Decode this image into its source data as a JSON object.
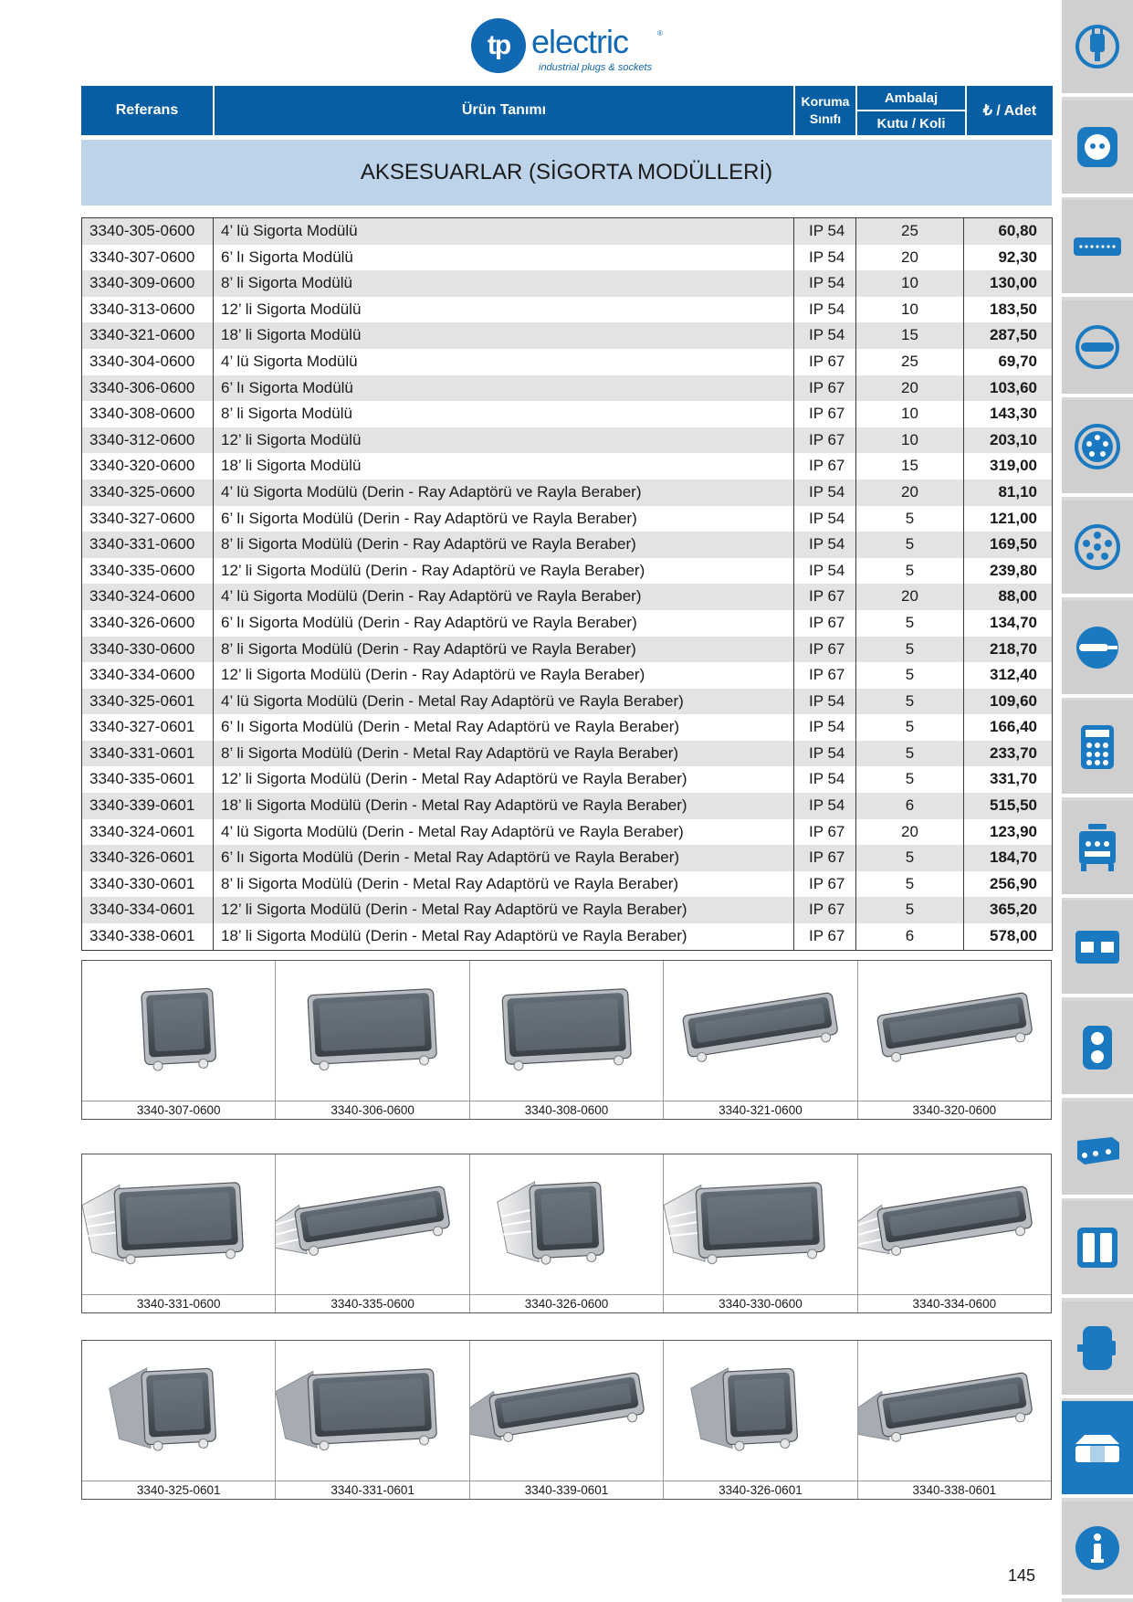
{
  "brand": {
    "logo_mark": "tp",
    "logo_word": "electric",
    "reg": "®",
    "tagline": "industrial plugs & sockets"
  },
  "header": {
    "referans": "Referans",
    "urun_tanimi": "Ürün Tanımı",
    "koruma_sinifi": "Koruma Sınıfı",
    "ambalaj": "Ambalaj",
    "kutu_koli": "Kutu / Koli",
    "fiyat": "₺ / Adet"
  },
  "section_title": "AKSESUARLAR (SİGORTA MODÜLLERİ)",
  "rows": [
    {
      "ref": "3340-305-0600",
      "desc": "4’ lü Sigorta Modülü",
      "ip": "IP 54",
      "pack": "25",
      "price": "60,80"
    },
    {
      "ref": "3340-307-0600",
      "desc": "6’ lı Sigorta Modülü",
      "ip": "IP 54",
      "pack": "20",
      "price": "92,30"
    },
    {
      "ref": "3340-309-0600",
      "desc": "8’ li Sigorta Modülü",
      "ip": "IP 54",
      "pack": "10",
      "price": "130,00"
    },
    {
      "ref": "3340-313-0600",
      "desc": "12’ li Sigorta Modülü",
      "ip": "IP 54",
      "pack": "10",
      "price": "183,50"
    },
    {
      "ref": "3340-321-0600",
      "desc": "18’ li Sigorta Modülü",
      "ip": "IP 54",
      "pack": "15",
      "price": "287,50"
    },
    {
      "ref": "3340-304-0600",
      "desc": "4’ lü Sigorta Modülü",
      "ip": "IP 67",
      "pack": "25",
      "price": "69,70"
    },
    {
      "ref": "3340-306-0600",
      "desc": "6’ lı Sigorta Modülü",
      "ip": "IP 67",
      "pack": "20",
      "price": "103,60"
    },
    {
      "ref": "3340-308-0600",
      "desc": "8’ li Sigorta Modülü",
      "ip": "IP 67",
      "pack": "10",
      "price": "143,30"
    },
    {
      "ref": "3340-312-0600",
      "desc": "12’ li Sigorta Modülü",
      "ip": "IP 67",
      "pack": "10",
      "price": "203,10"
    },
    {
      "ref": "3340-320-0600",
      "desc": "18’ li Sigorta Modülü",
      "ip": "IP 67",
      "pack": "15",
      "price": "319,00"
    },
    {
      "ref": "3340-325-0600",
      "desc": "4’ lü Sigorta Modülü (Derin - Ray Adaptörü ve Rayla Beraber)",
      "ip": "IP 54",
      "pack": "20",
      "price": "81,10"
    },
    {
      "ref": "3340-327-0600",
      "desc": "6’ lı Sigorta Modülü (Derin - Ray Adaptörü ve Rayla Beraber)",
      "ip": "IP 54",
      "pack": "5",
      "price": "121,00"
    },
    {
      "ref": "3340-331-0600",
      "desc": "8’ li Sigorta Modülü (Derin - Ray Adaptörü ve Rayla Beraber)",
      "ip": "IP 54",
      "pack": "5",
      "price": "169,50"
    },
    {
      "ref": "3340-335-0600",
      "desc": "12’ li Sigorta Modülü (Derin - Ray Adaptörü ve Rayla Beraber)",
      "ip": "IP 54",
      "pack": "5",
      "price": "239,80"
    },
    {
      "ref": "3340-324-0600",
      "desc": "4’ lü Sigorta Modülü (Derin - Ray Adaptörü ve Rayla Beraber)",
      "ip": "IP 67",
      "pack": "20",
      "price": "88,00"
    },
    {
      "ref": "3340-326-0600",
      "desc": "6’ lı Sigorta Modülü (Derin - Ray Adaptörü ve Rayla Beraber)",
      "ip": "IP 67",
      "pack": "5",
      "price": "134,70"
    },
    {
      "ref": "3340-330-0600",
      "desc": "8’ li Sigorta Modülü (Derin - Ray Adaptörü ve Rayla Beraber)",
      "ip": "IP 67",
      "pack": "5",
      "price": "218,70"
    },
    {
      "ref": "3340-334-0600",
      "desc": "12’ li Sigorta Modülü (Derin - Ray Adaptörü ve Rayla Beraber)",
      "ip": "IP 67",
      "pack": "5",
      "price": "312,40"
    },
    {
      "ref": "3340-325-0601",
      "desc": "4’ lü Sigorta Modülü (Derin - Metal Ray Adaptörü ve Rayla Beraber)",
      "ip": "IP 54",
      "pack": "5",
      "price": "109,60"
    },
    {
      "ref": "3340-327-0601",
      "desc": "6’ lı Sigorta Modülü (Derin - Metal Ray Adaptörü ve Rayla Beraber)",
      "ip": "IP 54",
      "pack": "5",
      "price": "166,40"
    },
    {
      "ref": "3340-331-0601",
      "desc": "8’ li Sigorta Modülü (Derin - Metal Ray Adaptörü ve Rayla Beraber)",
      "ip": "IP 54",
      "pack": "5",
      "price": "233,70"
    },
    {
      "ref": "3340-335-0601",
      "desc": "12’ li Sigorta Modülü (Derin - Metal Ray Adaptörü ve Rayla Beraber)",
      "ip": "IP 54",
      "pack": "5",
      "price": "331,70"
    },
    {
      "ref": "3340-339-0601",
      "desc": "18’ li Sigorta Modülü (Derin - Metal Ray Adaptörü ve Rayla Beraber)",
      "ip": "IP 54",
      "pack": "6",
      "price": "515,50"
    },
    {
      "ref": "3340-324-0601",
      "desc": "4’ lü Sigorta Modülü (Derin - Metal Ray Adaptörü ve Rayla Beraber)",
      "ip": "IP 67",
      "pack": "20",
      "price": "123,90"
    },
    {
      "ref": "3340-326-0601",
      "desc": "6’ lı Sigorta Modülü (Derin - Metal Ray Adaptörü ve Rayla Beraber)",
      "ip": "IP 67",
      "pack": "5",
      "price": "184,70"
    },
    {
      "ref": "3340-330-0601",
      "desc": "8’ li Sigorta Modülü (Derin - Metal Ray Adaptörü ve Rayla Beraber)",
      "ip": "IP 67",
      "pack": "5",
      "price": "256,90"
    },
    {
      "ref": "3340-334-0601",
      "desc": "12’ li Sigorta Modülü (Derin - Metal Ray Adaptörü ve Rayla Beraber)",
      "ip": "IP 67",
      "pack": "5",
      "price": "365,20"
    },
    {
      "ref": "3340-338-0601",
      "desc": "18’ li Sigorta Modülü (Derin - Metal Ray Adaptörü ve Rayla Beraber)",
      "ip": "IP 67",
      "pack": "6",
      "price": "578,00"
    }
  ],
  "galleries": [
    {
      "style": "flat",
      "items": [
        {
          "caption": "3340-307-0600",
          "size": "small"
        },
        {
          "caption": "3340-306-0600",
          "size": "medium"
        },
        {
          "caption": "3340-308-0600",
          "size": "medium"
        },
        {
          "caption": "3340-321-0600",
          "size": "long"
        },
        {
          "caption": "3340-320-0600",
          "size": "long"
        }
      ]
    },
    {
      "style": "deep-rail",
      "items": [
        {
          "caption": "3340-331-0600",
          "size": "medium"
        },
        {
          "caption": "3340-335-0600",
          "size": "long"
        },
        {
          "caption": "3340-326-0600",
          "size": "small"
        },
        {
          "caption": "3340-330-0600",
          "size": "medium"
        },
        {
          "caption": "3340-334-0600",
          "size": "long"
        }
      ]
    },
    {
      "style": "deep-metal",
      "items": [
        {
          "caption": "3340-325-0601",
          "size": "small"
        },
        {
          "caption": "3340-331-0601",
          "size": "medium"
        },
        {
          "caption": "3340-339-0601",
          "size": "long"
        },
        {
          "caption": "3340-326-0601",
          "size": "small"
        },
        {
          "caption": "3340-338-0601",
          "size": "long"
        }
      ]
    }
  ],
  "sidebar": [
    {
      "icon": "plug-icon",
      "active": false
    },
    {
      "icon": "socket-icon",
      "active": false
    },
    {
      "icon": "distribution-rail-icon",
      "active": false
    },
    {
      "icon": "flat-plug-icon",
      "active": false
    },
    {
      "icon": "multi-pin-socket-icon",
      "active": false
    },
    {
      "icon": "multi-pin-plug-icon",
      "active": false
    },
    {
      "icon": "cable-connector-icon",
      "active": false
    },
    {
      "icon": "distribution-panel-icon",
      "active": false
    },
    {
      "icon": "mobile-panel-icon",
      "active": false
    },
    {
      "icon": "combination-box-icon",
      "active": false
    },
    {
      "icon": "double-socket-icon",
      "active": false
    },
    {
      "icon": "junction-box-icon",
      "active": false
    },
    {
      "icon": "enclosure-icon",
      "active": false
    },
    {
      "icon": "cylinder-box-icon",
      "active": false
    },
    {
      "icon": "accessory-module-icon",
      "active": true
    },
    {
      "icon": "info-icon",
      "active": false
    }
  ],
  "colors": {
    "brand_blue": "#075ea3",
    "section_bg": "#bcd3ea",
    "row_alt": "#e3e3e3",
    "sidebar_active": "#1a79c0"
  },
  "page_number": "145"
}
